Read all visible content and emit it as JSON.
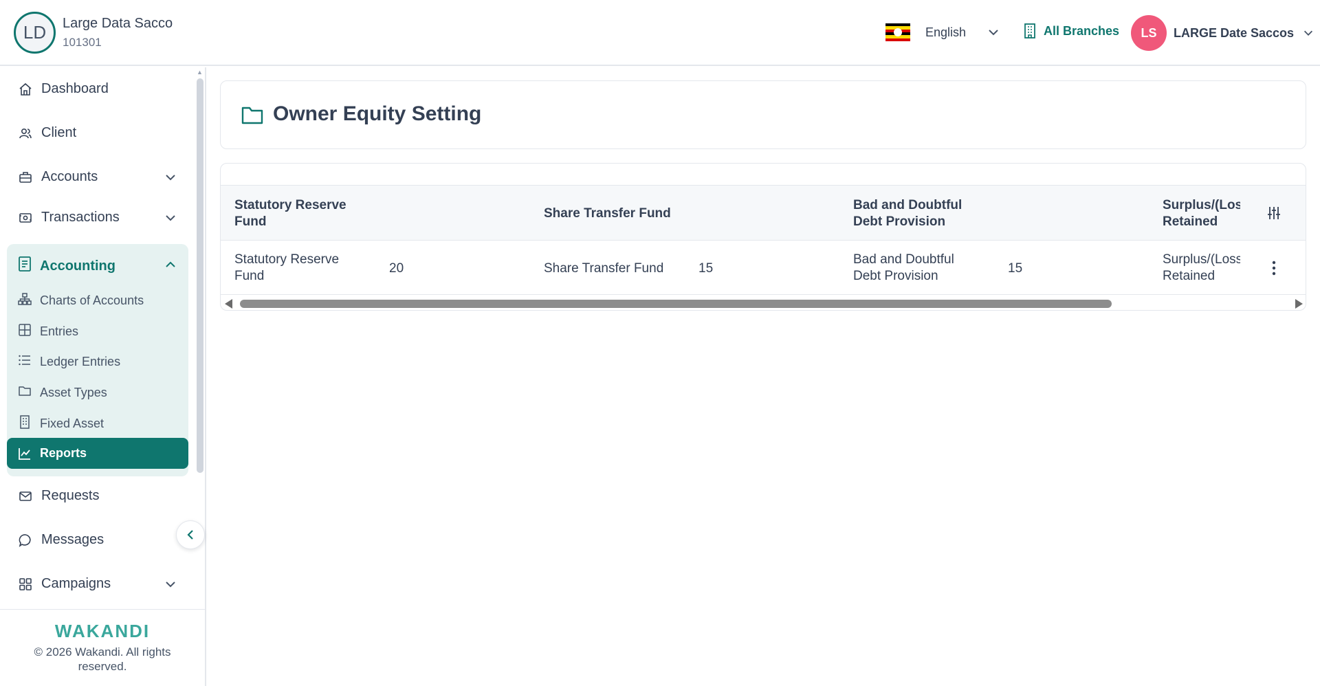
{
  "header": {
    "org_initials": "LD",
    "org_name": "Large Data Sacco",
    "org_code": "101301",
    "language": "English",
    "branches": "All Branches",
    "user_initials": "LS",
    "user_name": "LARGE Date Saccos"
  },
  "sidebar": {
    "items": [
      {
        "label": "Dashboard",
        "icon": "home-icon"
      },
      {
        "label": "Client",
        "icon": "users-icon"
      },
      {
        "label": "Accounts",
        "icon": "briefcase-icon"
      },
      {
        "label": "Transactions",
        "icon": "cash-icon"
      }
    ],
    "accounting": {
      "label": "Accounting",
      "icon": "document-icon",
      "subitems": [
        {
          "label": "Charts of Accounts",
          "icon": "hierarchy-icon"
        },
        {
          "label": "Entries",
          "icon": "grid-icon"
        },
        {
          "label": "Ledger Entries",
          "icon": "list-icon"
        },
        {
          "label": "Asset Types",
          "icon": "folder-icon"
        },
        {
          "label": "Fixed Asset",
          "icon": "building-icon"
        },
        {
          "label": "Reports",
          "icon": "chart-icon",
          "active": true
        }
      ]
    },
    "bottom_items": [
      {
        "label": "Requests",
        "icon": "mail-icon"
      },
      {
        "label": "Messages",
        "icon": "chat-icon"
      },
      {
        "label": "Campaigns",
        "icon": "apps-icon"
      }
    ],
    "brand": "WAKANDI",
    "copyright": "© 2026 Wakandi. All rights reserved."
  },
  "page": {
    "title": "Owner Equity Setting"
  },
  "table": {
    "headers": [
      "Statutory Reserve Fund",
      "Share Transfer Fund",
      "Bad and Doubtful Debt Provision",
      "Surplus/(Loss) Retained Earnings"
    ],
    "rows": [
      {
        "label_1": "Statutory Reserve Fund",
        "value_1": "20",
        "label_2": "Share Transfer Fund",
        "value_2": "15",
        "label_3": "Bad and Doubtful Debt Provision",
        "value_3": "15",
        "label_4": "Surplus/(Loss) Retained Earnings"
      }
    ]
  },
  "colors": {
    "accent": "#0f766e",
    "accent_light": "#e6f2f1",
    "avatar": "#f0587a"
  }
}
